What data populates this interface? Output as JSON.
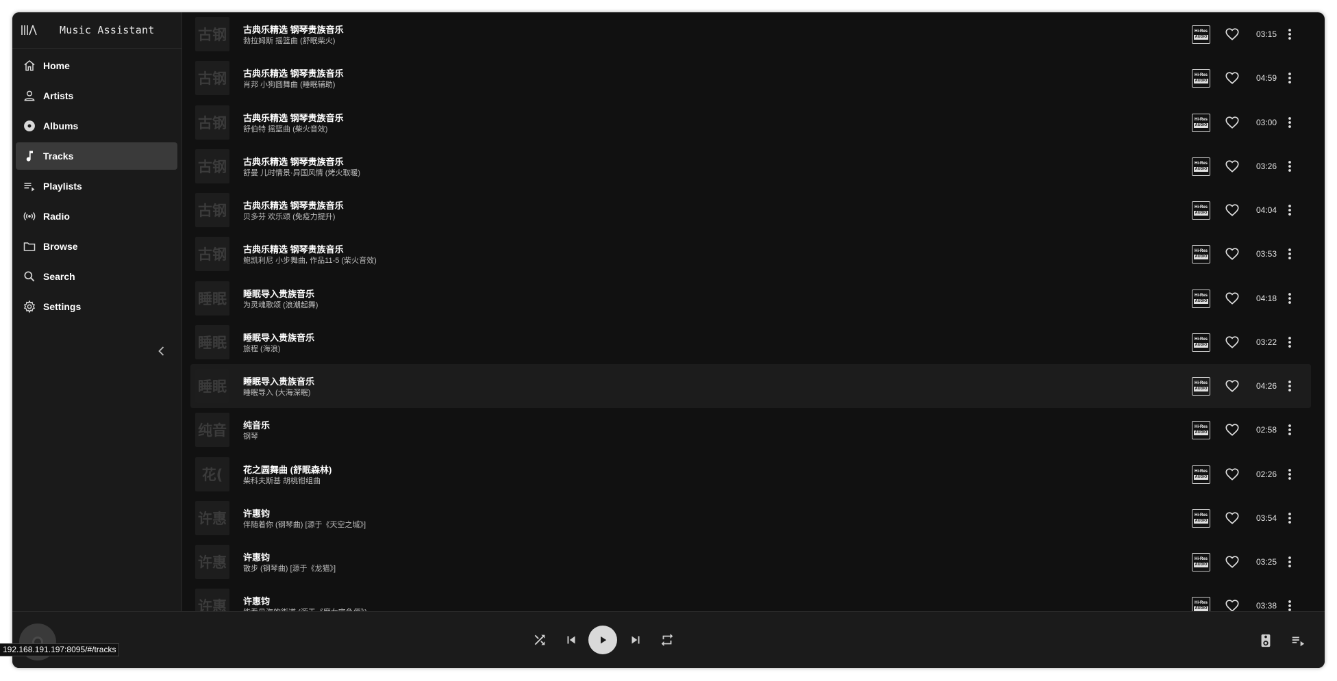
{
  "app": {
    "title": "Music Assistant",
    "logo_icon": "music-assistant-logo"
  },
  "sidebar": {
    "items": [
      {
        "label": "Home",
        "icon": "home-icon",
        "active": false
      },
      {
        "label": "Artists",
        "icon": "person-icon",
        "active": false
      },
      {
        "label": "Albums",
        "icon": "album-icon",
        "active": false
      },
      {
        "label": "Tracks",
        "icon": "music-note-icon",
        "active": true
      },
      {
        "label": "Playlists",
        "icon": "playlist-icon",
        "active": false
      },
      {
        "label": "Radio",
        "icon": "radio-icon",
        "active": false
      },
      {
        "label": "Browse",
        "icon": "folder-icon",
        "active": false
      },
      {
        "label": "Search",
        "icon": "search-icon",
        "active": false
      },
      {
        "label": "Settings",
        "icon": "gear-icon",
        "active": false
      }
    ],
    "collapse_icon": "chevron-left-icon"
  },
  "badge": {
    "line1": "Hi-Res",
    "line2": "AUDIO"
  },
  "tracks": [
    {
      "thumb": "古钢",
      "title": "古典乐精选 钢琴贵族音乐",
      "subtitle": "勃拉姆斯 摇篮曲 (舒眠柴火)",
      "duration": "03:15"
    },
    {
      "thumb": "古钢",
      "title": "古典乐精选 钢琴贵族音乐",
      "subtitle": "肖邦 小狗圆舞曲 (睡眠辅助)",
      "duration": "04:59"
    },
    {
      "thumb": "古钢",
      "title": "古典乐精选 钢琴贵族音乐",
      "subtitle": "舒伯特 摇篮曲 (柴火音效)",
      "duration": "03:00"
    },
    {
      "thumb": "古钢",
      "title": "古典乐精选 钢琴贵族音乐",
      "subtitle": "舒曼 儿时情景·异国风情 (烤火取暖)",
      "duration": "03:26"
    },
    {
      "thumb": "古钢",
      "title": "古典乐精选 钢琴贵族音乐",
      "subtitle": "贝多芬 欢乐颂 (免疫力提升)",
      "duration": "04:04"
    },
    {
      "thumb": "古钢",
      "title": "古典乐精选 钢琴贵族音乐",
      "subtitle": "鲍凯利尼 小步舞曲, 作品11-5 (柴火音效)",
      "duration": "03:53"
    },
    {
      "thumb": "睡眠",
      "title": "睡眠导入贵族音乐",
      "subtitle": "为灵魂歌颂 (浪潮起舞)",
      "duration": "04:18"
    },
    {
      "thumb": "睡眠",
      "title": "睡眠导入贵族音乐",
      "subtitle": "旅程 (海浪)",
      "duration": "03:22"
    },
    {
      "thumb": "睡眠",
      "title": "睡眠导入贵族音乐",
      "subtitle": "睡眠导入 (大海深眠)",
      "duration": "04:26"
    },
    {
      "thumb": "纯音",
      "title": "纯音乐",
      "subtitle": "钢琴",
      "duration": "02:58"
    },
    {
      "thumb": "花(",
      "title": "花之圆舞曲 (舒眠森林)",
      "subtitle": "柴科夫斯基 胡桃钳组曲",
      "duration": "02:26"
    },
    {
      "thumb": "许惠",
      "title": "许惠钧",
      "subtitle": "伴随着你 (钢琴曲) [源于《天空之城》]",
      "duration": "03:54"
    },
    {
      "thumb": "许惠",
      "title": "许惠钧",
      "subtitle": "散步 (钢琴曲) [源于《龙猫》]",
      "duration": "03:25"
    },
    {
      "thumb": "许惠",
      "title": "许惠钧",
      "subtitle": "能看见海的街道 (源于《魔女宅急便》)",
      "duration": "03:38"
    }
  ],
  "player": {
    "controls": [
      "shuffle-icon",
      "skip-previous-icon",
      "play-icon",
      "skip-next-icon",
      "repeat-icon"
    ],
    "right_icons": [
      "speaker-icon",
      "queue-icon"
    ]
  },
  "status_url": "192.168.191.197:8095/#/tracks"
}
